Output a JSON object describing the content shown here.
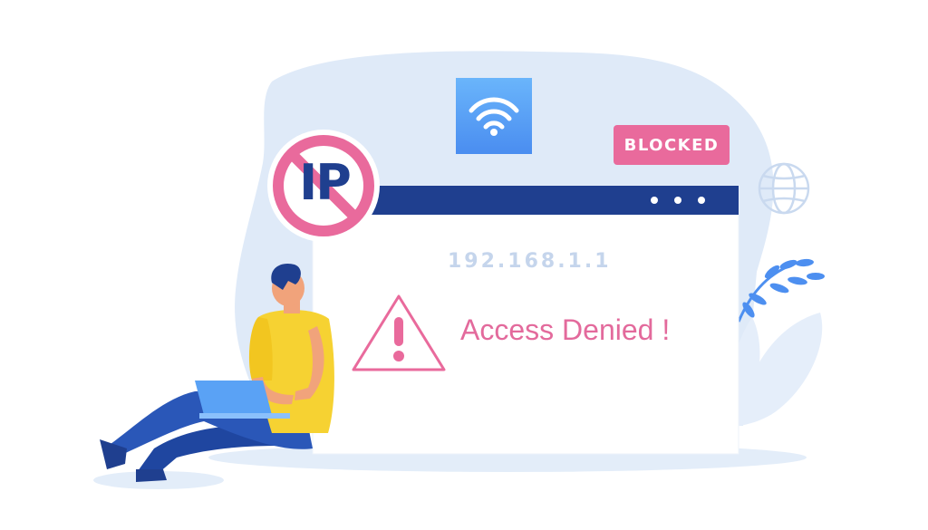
{
  "ip_sign": {
    "text": "IP"
  },
  "status_badge": {
    "text": "BLOCKED"
  },
  "ip_address": "192.168.1.1",
  "message": "Access Denied !",
  "icons": [
    "wifi-icon",
    "globe-icon",
    "warning-icon",
    "no-entry-icon",
    "window-dots-icon"
  ],
  "colors": {
    "accent_pink": "#e96a9c",
    "navy": "#1f3f8f",
    "blob": "#dce9f8",
    "wifi_tile": "#5aa2f5",
    "window": "#ffffff",
    "shirt": "#f6d232",
    "jeans": "#1f46a0"
  }
}
